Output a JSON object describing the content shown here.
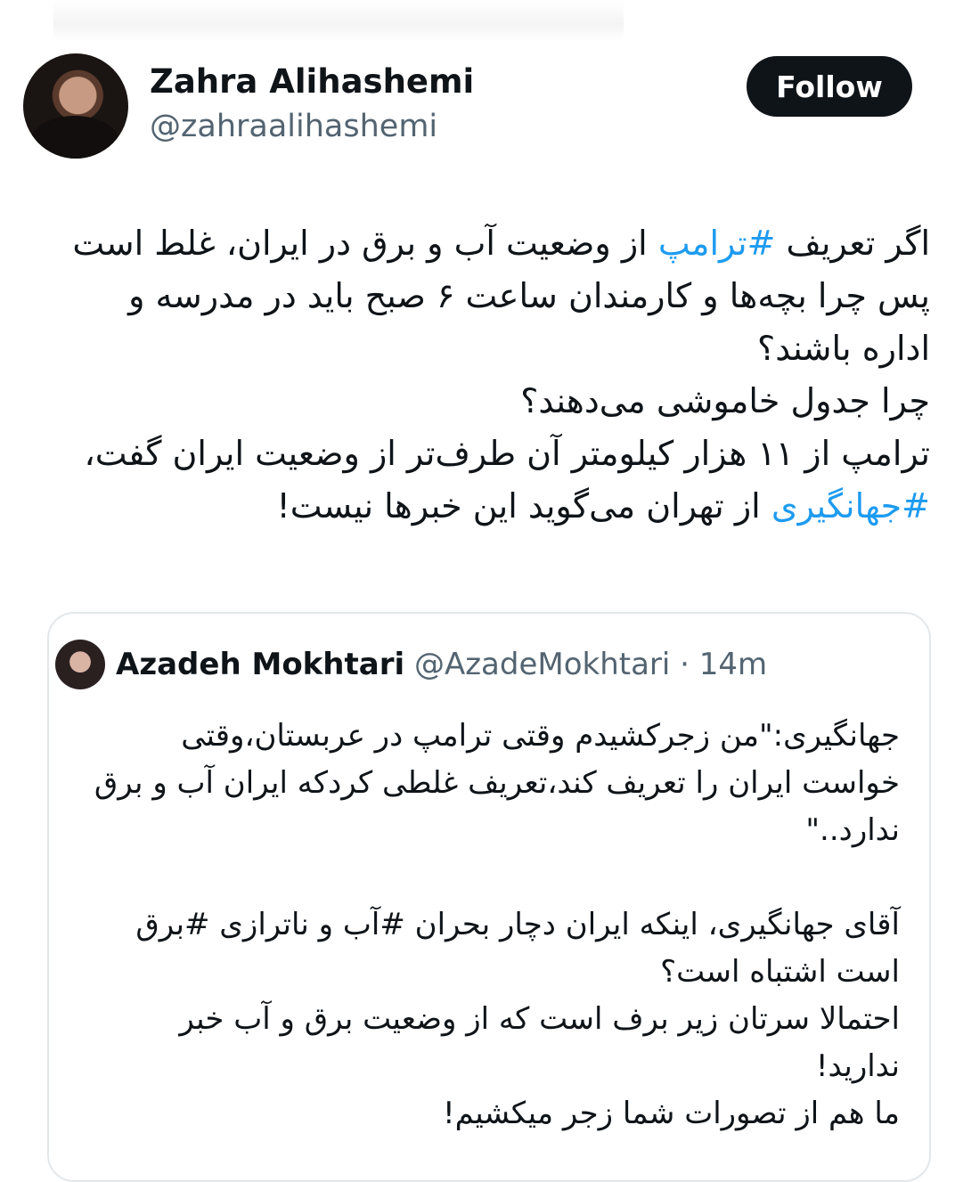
{
  "author": {
    "name": "Zahra Alihashemi",
    "handle": "@zahraalihashemi",
    "follow_label": "Follow"
  },
  "tweet": {
    "lines": [
      [
        {
          "text": "اگر تعریف "
        },
        {
          "text": "#ترامپ",
          "hashtag": true
        },
        {
          "text": " از وضعیت آب و برق در ایران، غلط است"
        }
      ],
      [
        {
          "text": "پس چرا بچه‌ها و کارمندان ساعت ۶ صبح باید در مدرسه و"
        }
      ],
      [
        {
          "text": "اداره باشند؟"
        }
      ],
      [
        {
          "text": "چرا جدول خاموشی می‌دهند؟"
        }
      ],
      [
        {
          "text": "ترامپ از ۱۱ هزار کیلومتر آن طرف‌تر از وضعیت ایران گفت،"
        }
      ],
      [
        {
          "text": "#جهانگیری",
          "hashtag": true
        },
        {
          "text": " از تهران می‌گوید این خبرها نیست!"
        }
      ]
    ]
  },
  "quote": {
    "name": "Azadeh Mokhtari",
    "handle": "@AzadeMokhtari",
    "separator": " · ",
    "time": "14m",
    "lines": [
      "جهانگیری:\"من زجرکشیدم وقتی ترامپ در عربستان،وقتی",
      "خواست ایران را تعریف کند،تعریف غلطی کردکه ایران آب و برق",
      "ندارد..\"",
      "",
      "آقای جهانگیری، اینکه ایران دچار بحران #آب و ناترازی #برق",
      "است اشتباه است؟",
      "احتمالا سرتان زیر برف است که از وضعیت برق و آب خبر",
      "ندارید!",
      "ما هم از تصورات شما زجر میکشیم!"
    ]
  },
  "colors": {
    "hashtag": "#1d9bf0",
    "text": "#0f1419",
    "secondary": "#536471",
    "follow_bg": "#0f1419"
  }
}
